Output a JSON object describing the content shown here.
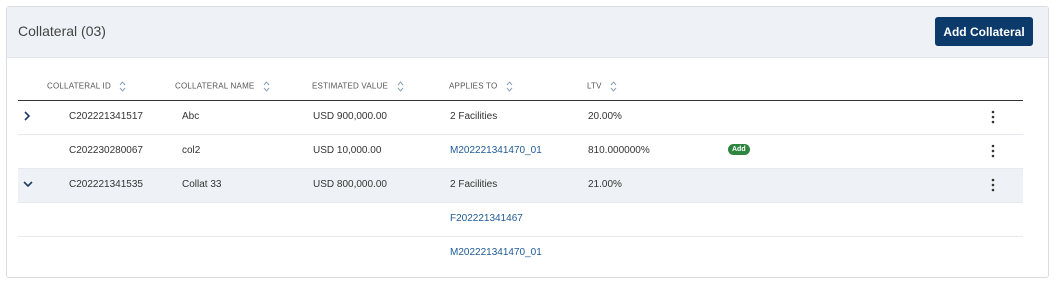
{
  "header": {
    "title": "Collateral (03)",
    "add_button_label": "Add Collateral"
  },
  "table": {
    "columns": [
      "COLLATERAL ID",
      "COLLATERAL NAME",
      "ESTIMATED VALUE",
      "APPLIES TO",
      "LTV"
    ],
    "rows": [
      {
        "id": "C202221341517",
        "name": "Abc",
        "value": "USD 900,000.00",
        "applies_to": "2 Facilities",
        "ltv": "20.00%"
      },
      {
        "id": "C202230280067",
        "name": "col2",
        "value": "USD 10,000.00",
        "applies_to": "M202221341470_01",
        "ltv": "810.000000%",
        "badge": "Add"
      },
      {
        "id": "C202221341535",
        "name": "Collat 33",
        "value": "USD 800,000.00",
        "applies_to": "2 Facilities",
        "ltv": "21.00%"
      }
    ],
    "sub_rows": [
      "F202221341467",
      "M202221341470_01"
    ]
  },
  "colors": {
    "primary": "#0c3a6b",
    "link": "#1f5a96",
    "badge": "#2e8540",
    "header_bg": "#eef2f6"
  }
}
